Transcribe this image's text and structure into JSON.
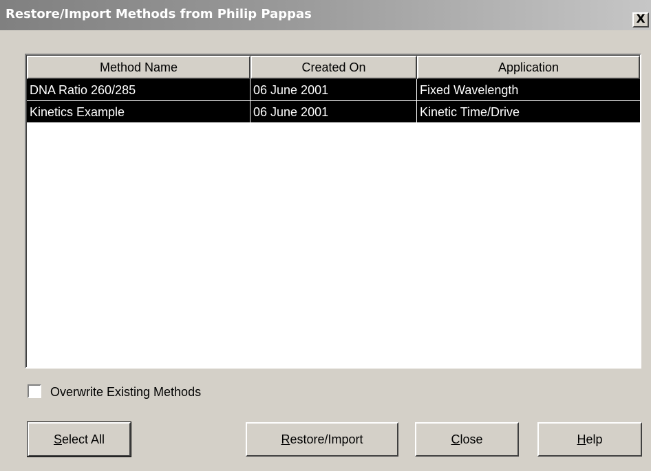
{
  "window": {
    "title": "Restore/Import Methods from Philip Pappas",
    "close_glyph": "X"
  },
  "table": {
    "columns": [
      "Method Name",
      "Created On",
      "Application"
    ],
    "rows": [
      {
        "method_name": "DNA Ratio 260/285",
        "created_on": "06 June 2001",
        "application": "Fixed Wavelength",
        "selected": true
      },
      {
        "method_name": "Kinetics Example",
        "created_on": "06 June 2001",
        "application": "Kinetic Time/Drive",
        "selected": true
      }
    ]
  },
  "options": {
    "overwrite_label": "Overwrite Existing Methods",
    "overwrite_checked": false
  },
  "buttons": {
    "select_all": {
      "mnemonic": "S",
      "rest": "elect All"
    },
    "restore_import": {
      "mnemonic": "R",
      "rest": "estore/Import"
    },
    "close": {
      "mnemonic": "C",
      "rest": "lose"
    },
    "help": {
      "mnemonic": "H",
      "rest": "elp"
    }
  },
  "colors": {
    "face": "#d4d0c8",
    "selection_bg": "#000000",
    "selection_text": "#ffffff"
  }
}
